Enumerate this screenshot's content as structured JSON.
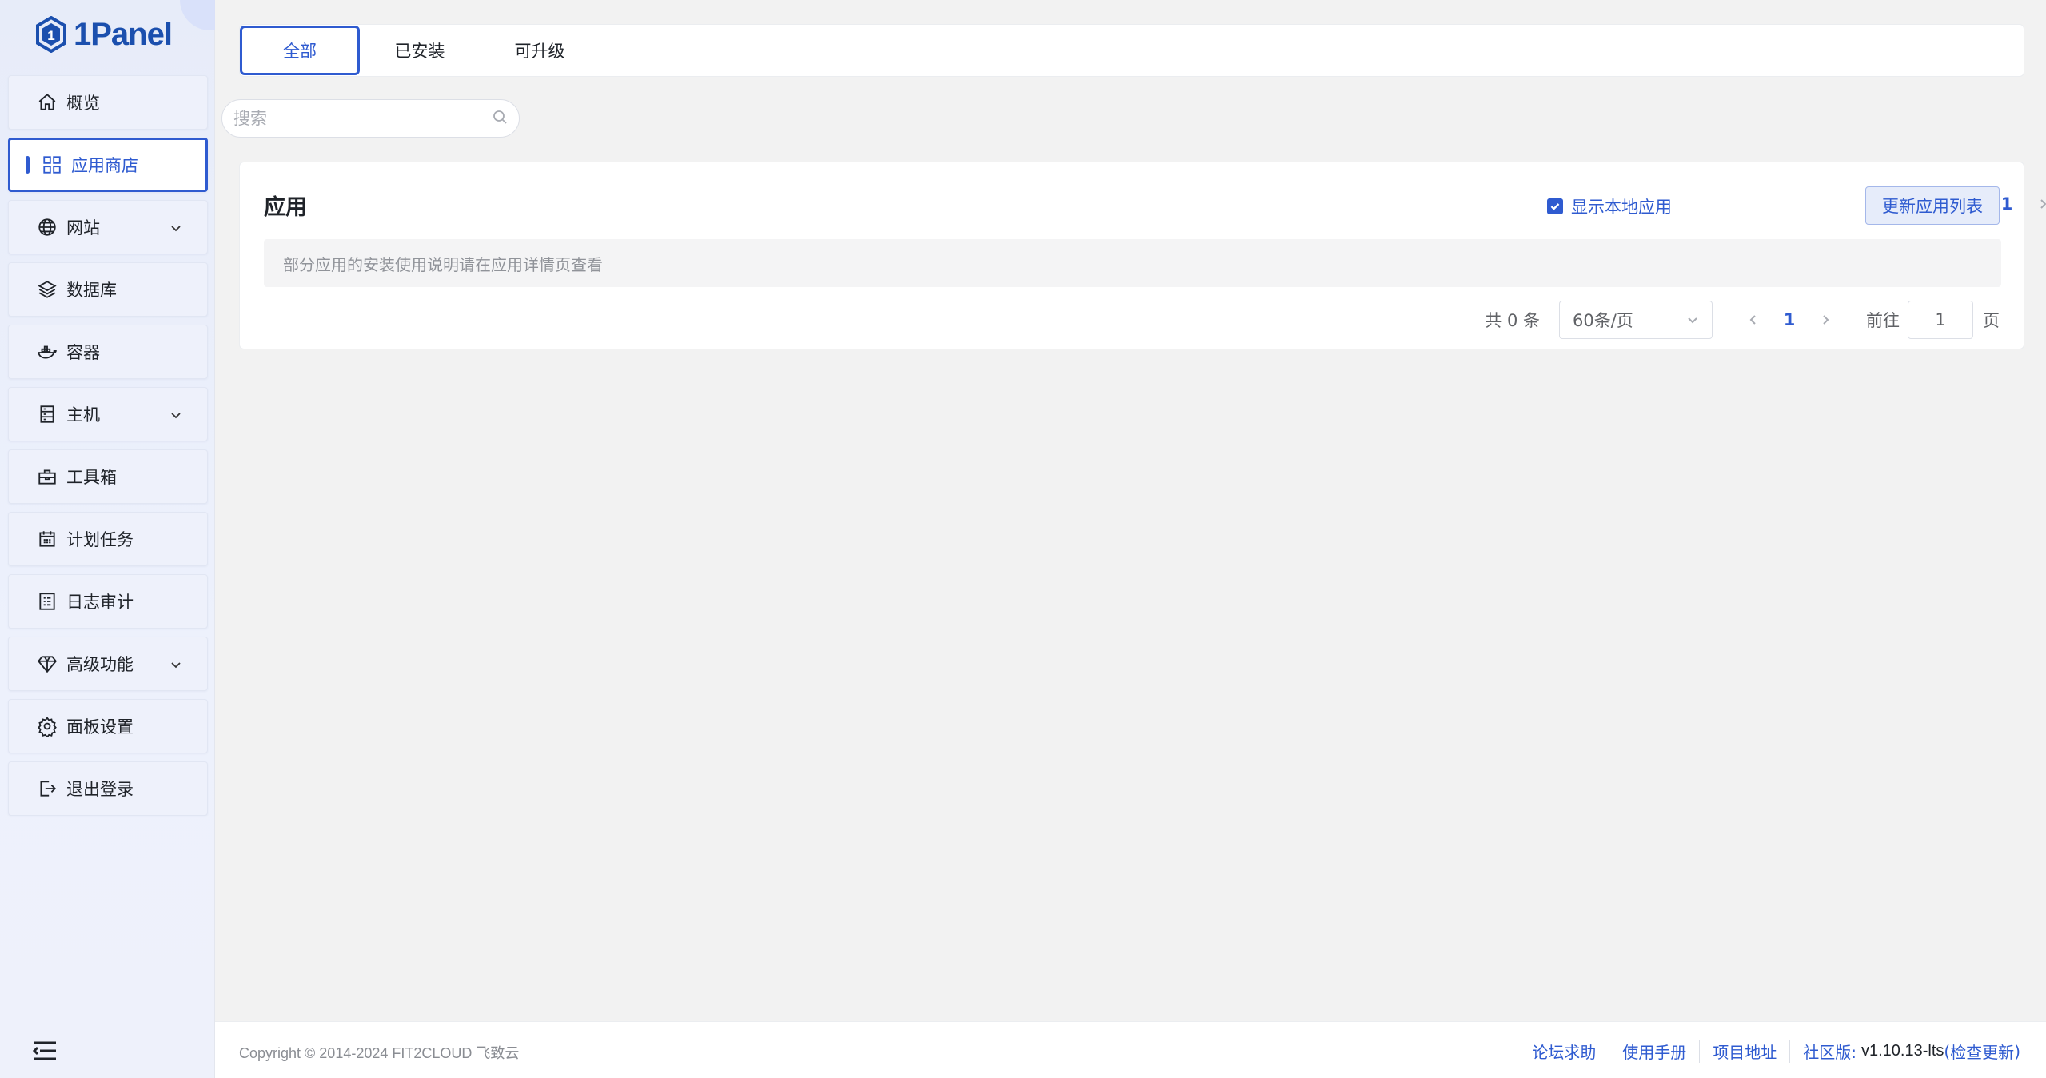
{
  "brand": {
    "name": "1Panel"
  },
  "sidebar": {
    "items": [
      {
        "label": "概览",
        "icon": "home-icon",
        "expandable": false
      },
      {
        "label": "应用商店",
        "icon": "apps-grid-icon",
        "expandable": false,
        "active": true
      },
      {
        "label": "网站",
        "icon": "globe-icon",
        "expandable": true
      },
      {
        "label": "数据库",
        "icon": "layers-icon",
        "expandable": false
      },
      {
        "label": "容器",
        "icon": "docker-icon",
        "expandable": false
      },
      {
        "label": "主机",
        "icon": "server-icon",
        "expandable": true
      },
      {
        "label": "工具箱",
        "icon": "toolbox-icon",
        "expandable": false
      },
      {
        "label": "计划任务",
        "icon": "calendar-icon",
        "expandable": false
      },
      {
        "label": "日志审计",
        "icon": "log-icon",
        "expandable": false
      },
      {
        "label": "高级功能",
        "icon": "diamond-icon",
        "expandable": true
      },
      {
        "label": "面板设置",
        "icon": "gear-icon",
        "expandable": false
      },
      {
        "label": "退出登录",
        "icon": "logout-icon",
        "expandable": false
      }
    ]
  },
  "tabs": [
    {
      "label": "全部",
      "active": true
    },
    {
      "label": "已安装",
      "active": false
    },
    {
      "label": "可升级",
      "active": false
    }
  ],
  "search": {
    "placeholder": "搜索",
    "value": ""
  },
  "apps_card": {
    "title": "应用",
    "show_local_label": "显示本地应用",
    "show_local_checked": true,
    "top_page": "1",
    "refresh_label": "更新应用列表",
    "notice": "部分应用的安装使用说明请在应用详情页查看",
    "total_label": "共 0 条",
    "page_size": "60条/页",
    "bottom_page": "1",
    "goto_label": "前往",
    "goto_value": "1",
    "page_suffix": "页"
  },
  "footer": {
    "copyright": "Copyright © 2014-2024 FIT2CLOUD 飞致云",
    "links": [
      "论坛求助",
      "使用手册",
      "项目地址"
    ],
    "edition": "社区版:",
    "version": "v1.10.13-lts",
    "paren_open": "(",
    "check_update": "检查更新",
    "paren_close": ")"
  },
  "colors": {
    "accent": "#2f5bd0",
    "sidebar_bg": "#e9eefb",
    "page_bg": "#f2f2f2"
  }
}
